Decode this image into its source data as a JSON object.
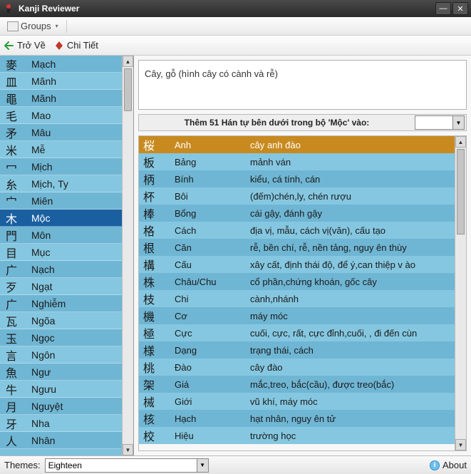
{
  "titlebar": {
    "app_name": "Kanji Reviewer"
  },
  "toolbar": {
    "groups": "Groups",
    "back": "Trở Về",
    "detail": "Chi Tiết"
  },
  "definition": "Cây, gỗ (hình cây có cành và rễ)",
  "filter_label": "Thêm 51 Hán tự bên dưới trong bộ 'Mộc' vào:",
  "left_selected_index": 9,
  "left_items": [
    {
      "k": "麥",
      "r": "Mạch"
    },
    {
      "k": "皿",
      "r": "Mãnh"
    },
    {
      "k": "黽",
      "r": "Mãnh"
    },
    {
      "k": "毛",
      "r": "Mao"
    },
    {
      "k": "矛",
      "r": "Mâu"
    },
    {
      "k": "米",
      "r": "Mễ"
    },
    {
      "k": "冖",
      "r": "Mịch"
    },
    {
      "k": "糸",
      "r": "Mịch, Ty"
    },
    {
      "k": "宀",
      "r": "Miên"
    },
    {
      "k": "木",
      "r": "Mộc"
    },
    {
      "k": "門",
      "r": "Môn"
    },
    {
      "k": "目",
      "r": "Mục"
    },
    {
      "k": "广",
      "r": "Nạch"
    },
    {
      "k": "歹",
      "r": "Ngạt"
    },
    {
      "k": "广",
      "r": "Nghiễm"
    },
    {
      "k": "瓦",
      "r": "Ngõa"
    },
    {
      "k": "玉",
      "r": "Ngọc"
    },
    {
      "k": "言",
      "r": "Ngôn"
    },
    {
      "k": "魚",
      "r": "Ngư"
    },
    {
      "k": "牛",
      "r": "Ngưu"
    },
    {
      "k": "月",
      "r": "Nguyệt"
    },
    {
      "k": "牙",
      "r": "Nha"
    },
    {
      "k": "人",
      "r": "Nhân"
    }
  ],
  "grid_selected_index": 0,
  "grid_items": [
    {
      "k": "桜",
      "r": "Anh",
      "m": "cây anh đào"
    },
    {
      "k": "板",
      "r": "Bảng",
      "m": "mảnh ván"
    },
    {
      "k": "柄",
      "r": "Bính",
      "m": "kiểu, cá tính, cán"
    },
    {
      "k": "杯",
      "r": "Bôi",
      "m": "(đếm)chén,ly, chén rượu"
    },
    {
      "k": "棒",
      "r": "Bổng",
      "m": "cái gậy, đánh gậy"
    },
    {
      "k": "格",
      "r": "Cách",
      "m": "địa vị, mẫu, cách vị(văn), cấu tạo"
    },
    {
      "k": "根",
      "r": "Căn",
      "m": "rễ, bền chí, rễ, nền tảng, nguy ên thùy"
    },
    {
      "k": "構",
      "r": "Cấu",
      "m": "xây cất, định thái độ, để ý,can thiệp v ào"
    },
    {
      "k": "株",
      "r": "Châu/Chu",
      "m": "cổ phần,chứng khoán, gốc cây"
    },
    {
      "k": "枝",
      "r": "Chi",
      "m": "cành,nhánh"
    },
    {
      "k": "機",
      "r": "Cơ",
      "m": "máy móc"
    },
    {
      "k": "極",
      "r": "Cực",
      "m": "cuối, cực, rất, cực đỉnh,cuối, , đi đến cùn"
    },
    {
      "k": "様",
      "r": "Dạng",
      "m": "trạng thái, cách"
    },
    {
      "k": "桃",
      "r": "Đào",
      "m": "cây đào"
    },
    {
      "k": "架",
      "r": "Giá",
      "m": "mắc,treo, bắc(cầu), được treo(bắc)"
    },
    {
      "k": "械",
      "r": "Giới",
      "m": "vũ khí, máy móc"
    },
    {
      "k": "核",
      "r": "Hạch",
      "m": "hạt nhân, nguy ên tử"
    },
    {
      "k": "校",
      "r": "Hiệu",
      "m": "trường học"
    }
  ],
  "status": {
    "themes_label": "Themes:",
    "theme_value": "Eighteen",
    "about": "About"
  }
}
